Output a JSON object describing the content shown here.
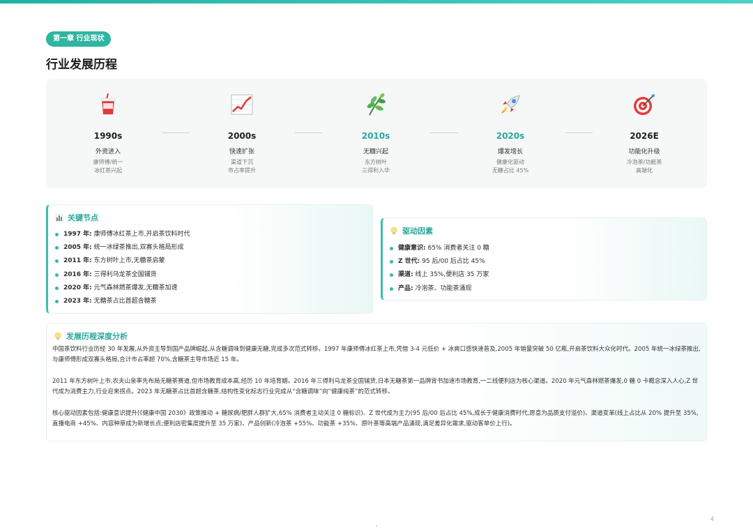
{
  "chapter": "第一章 行业现状",
  "title": "行业发展历程",
  "timeline": [
    {
      "year": "1990s",
      "name": "外资进入",
      "desc1": "康师傅/统一",
      "desc2": "冰红茶兴起",
      "icon": "drink-cup-icon"
    },
    {
      "year": "2000s",
      "name": "快速扩张",
      "desc1": "渠道下沉",
      "desc2": "市占率提升",
      "icon": "chart-up-icon"
    },
    {
      "year": "2010s",
      "name": "无糖兴起",
      "desc1": "东方树叶",
      "desc2": "三得利入华",
      "icon": "herb-icon"
    },
    {
      "year": "2020s",
      "name": "爆发增长",
      "desc1": "健康化驱动",
      "desc2": "无糖占比 45%",
      "icon": "rocket-icon"
    },
    {
      "year": "2026E",
      "name": "功能化升级",
      "desc1": "冷泡茶/功能茶",
      "desc2": "高端化",
      "icon": "target-icon"
    }
  ],
  "key_nodes": {
    "title": "关键节点",
    "icon": "bar-chart-icon",
    "items": [
      {
        "label": "1997 年:",
        "text": "康师傅冰红茶上市,开启茶饮料时代"
      },
      {
        "label": "2005 年:",
        "text": "统一冰绿茶推出,双寡头格局形成"
      },
      {
        "label": "2011 年:",
        "text": "东方树叶上市,无糖茶启蒙"
      },
      {
        "label": "2016 年:",
        "text": "三得利乌龙茶全国铺货"
      },
      {
        "label": "2020 年:",
        "text": "元气森林燃茶爆发,无糖茶加速"
      },
      {
        "label": "2023 年:",
        "text": "无糖茶占比首超含糖茶"
      }
    ]
  },
  "drivers": {
    "title": "驱动因素",
    "icon": "lightbulb-icon",
    "items": [
      {
        "label": "健康意识:",
        "text": "65% 消费者关注 0 糖"
      },
      {
        "label": "Z 世代:",
        "text": "95 后/00 后占比 45%"
      },
      {
        "label": "渠道:",
        "text": "线上 35%,便利店 35 万家"
      },
      {
        "label": "产品:",
        "text": "冷泡茶、功能茶涌现"
      }
    ]
  },
  "analysis": {
    "title": "发展历程深度分析",
    "icon": "lightbulb-icon",
    "paragraphs": [
      "中国茶饮料行业历经 30 年发展,从外资主导到国产品牌崛起,从含糖调味到健康无糖,完成多次范式转移。1997 年康师傅冰红茶上市,凭借 3-4 元低价 + 冰爽口感快速普及,2005 年销量突破 50 亿瓶,开启茶饮料大众化时代。2005 年统一冰绿茶推出,与康师傅形成双寡头格局,合计市占率超 70%,含糖茶主导市场近 15 年。",
      "2011 年东方树叶上市,农夫山泉率先布局无糖茶赛道,但市场教育成本高,经历 10 年培育期。2016 年三得利乌龙茶全国铺货,日本无糖茶第一品牌背书加速市场教育,一二线便利店为核心渠道。2020 年元气森林燃茶爆发,0 糖 0 卡概念深入人心,Z 世代成为消费主力,行业迎来拐点。2023 年无糖茶占比首超含糖茶,结构性变化标志行业完成从“含糖调味”向“健康纯茶”的范式转移。",
      "核心驱动因素包括:健康意识提升(《健康中国 2030》政策推动 + 糖尿病/肥胖人群扩大,65% 消费者主动关注 0 糖标识)、Z 世代成为主力(95 后/00 后占比 45%,成长于健康消费时代,愿意为品质支付溢价)、渠道变革(线上占比从 20% 提升至 35%,直播电商 +45%、内容种草成为新增长点;便利店密集度提升至 35 万家)、产品创新(冷泡茶 +55%、功能茶 +35%、原叶茶等高端产品涌现,满足差异化需求,驱动客单价上行)。"
    ]
  },
  "page_number": "4",
  "footer_mark": "•",
  "colors": {
    "accent": "#2fb5a0",
    "teal_text": "#2aa99a"
  }
}
